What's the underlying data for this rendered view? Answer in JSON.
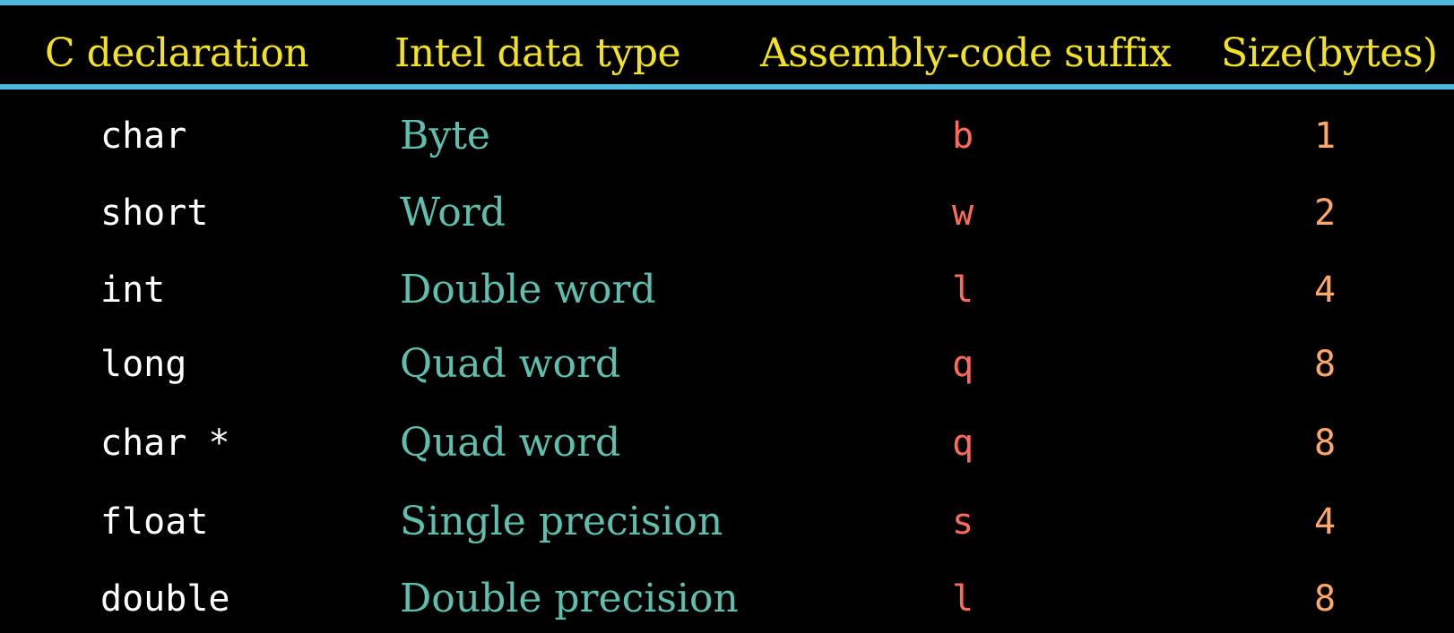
{
  "table": {
    "headers": {
      "c_declaration": "C declaration",
      "intel_data_type": "Intel data type",
      "assembly_suffix": "Assembly-code suffix",
      "size_bytes": "Size(bytes)"
    },
    "rows": [
      {
        "decl": "char",
        "intel": "Byte",
        "suffix": "b",
        "size": "1"
      },
      {
        "decl": "short",
        "intel": "Word",
        "suffix": "w",
        "size": "2"
      },
      {
        "decl": "int",
        "intel": "Double word",
        "suffix": "l",
        "size": "4"
      },
      {
        "decl": "long",
        "intel": "Quad word",
        "suffix": "q",
        "size": "8"
      },
      {
        "decl": "char *",
        "intel": "Quad word",
        "suffix": "q",
        "size": "8"
      },
      {
        "decl": "float",
        "intel": "Single precision",
        "suffix": "s",
        "size": "4"
      },
      {
        "decl": "double",
        "intel": "Double precision",
        "suffix": "l",
        "size": "8"
      }
    ]
  },
  "colors": {
    "background": "#000000",
    "rule": "#4fb8dd",
    "header_text": "#f2e21f",
    "c_declaration_text": "#ffffff",
    "intel_type_text": "#5fbfae",
    "suffix_text": "#ff6a5a",
    "size_text": "#ffa66b"
  }
}
